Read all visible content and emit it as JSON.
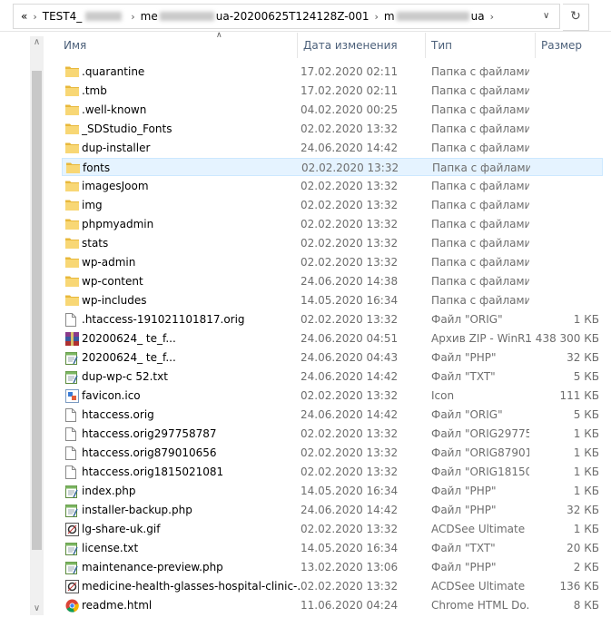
{
  "address": {
    "overflow": "«",
    "segments": [
      "TEST4_",
      "me",
      "ua-20200625T124128Z-001",
      "m",
      "ua"
    ],
    "refresh_icon": "refresh-icon"
  },
  "columns": {
    "name": "Имя",
    "date": "Дата изменения",
    "type": "Тип",
    "size": "Размер"
  },
  "rows": [
    {
      "name": ".quarantine",
      "date": "17.02.2020 02:11",
      "type": "Папка с файлами",
      "size": "",
      "icon": "folder"
    },
    {
      "name": ".tmb",
      "date": "17.02.2020 02:11",
      "type": "Папка с файлами",
      "size": "",
      "icon": "folder"
    },
    {
      "name": ".well-known",
      "date": "04.02.2020 00:25",
      "type": "Папка с файлами",
      "size": "",
      "icon": "folder"
    },
    {
      "name": "_SDStudio_Fonts",
      "date": "02.02.2020 13:32",
      "type": "Папка с файлами",
      "size": "",
      "icon": "folder"
    },
    {
      "name": "dup-installer",
      "date": "24.06.2020 14:42",
      "type": "Папка с файлами",
      "size": "",
      "icon": "folder"
    },
    {
      "name": "fonts",
      "date": "02.02.2020 13:32",
      "type": "Папка с файлами",
      "size": "",
      "icon": "folder",
      "selected": true
    },
    {
      "name": "imagesJoom",
      "date": "02.02.2020 13:32",
      "type": "Папка с файлами",
      "size": "",
      "icon": "folder"
    },
    {
      "name": "img",
      "date": "02.02.2020 13:32",
      "type": "Папка с файлами",
      "size": "",
      "icon": "folder"
    },
    {
      "name": "phpmyadmin",
      "date": "02.02.2020 13:32",
      "type": "Папка с файлами",
      "size": "",
      "icon": "folder"
    },
    {
      "name": "stats",
      "date": "02.02.2020 13:32",
      "type": "Папка с файлами",
      "size": "",
      "icon": "folder"
    },
    {
      "name": "wp-admin",
      "date": "02.02.2020 13:32",
      "type": "Папка с файлами",
      "size": "",
      "icon": "folder"
    },
    {
      "name": "wp-content",
      "date": "24.06.2020 14:38",
      "type": "Папка с файлами",
      "size": "",
      "icon": "folder"
    },
    {
      "name": "wp-includes",
      "date": "14.05.2020 16:34",
      "type": "Папка с файлами",
      "size": "",
      "icon": "folder"
    },
    {
      "name": ".htaccess-191021101817.orig",
      "date": "02.02.2020 13:32",
      "type": "Файл \"ORIG\"",
      "size": "1 КБ",
      "icon": "file"
    },
    {
      "name": "20200624_            te_f...",
      "date": "24.06.2020 04:51",
      "type": "Архив ZIP - WinR...",
      "size": "1 438 300 КБ",
      "icon": "archive"
    },
    {
      "name": "20200624_            te_f...",
      "date": "24.06.2020 04:43",
      "type": "Файл \"PHP\"",
      "size": "32 КБ",
      "icon": "notepad"
    },
    {
      "name": "dup-wp-c            52.txt",
      "date": "24.06.2020 14:42",
      "type": "Файл \"TXT\"",
      "size": "5 КБ",
      "icon": "notepad"
    },
    {
      "name": "favicon.ico",
      "date": "02.02.2020 13:32",
      "type": "Icon",
      "size": "111 КБ",
      "icon": "image"
    },
    {
      "name": "htaccess.orig",
      "date": "24.06.2020 14:42",
      "type": "Файл \"ORIG\"",
      "size": "5 КБ",
      "icon": "file"
    },
    {
      "name": "htaccess.orig297758787",
      "date": "02.02.2020 13:32",
      "type": "Файл \"ORIG29775...",
      "size": "1 КБ",
      "icon": "file"
    },
    {
      "name": "htaccess.orig879010656",
      "date": "02.02.2020 13:32",
      "type": "Файл \"ORIG87901...",
      "size": "1 КБ",
      "icon": "file"
    },
    {
      "name": "htaccess.orig1815021081",
      "date": "02.02.2020 13:32",
      "type": "Файл \"ORIG18150...",
      "size": "1 КБ",
      "icon": "file"
    },
    {
      "name": "index.php",
      "date": "14.05.2020 16:34",
      "type": "Файл \"PHP\"",
      "size": "1 КБ",
      "icon": "notepad"
    },
    {
      "name": "installer-backup.php",
      "date": "24.06.2020 14:42",
      "type": "Файл \"PHP\"",
      "size": "32 КБ",
      "icon": "notepad"
    },
    {
      "name": "lg-share-uk.gif",
      "date": "02.02.2020 13:32",
      "type": "ACDSee Ultimate ...",
      "size": "1 КБ",
      "icon": "acdsee"
    },
    {
      "name": "license.txt",
      "date": "14.05.2020 16:34",
      "type": "Файл \"TXT\"",
      "size": "20 КБ",
      "icon": "notepad"
    },
    {
      "name": "maintenance-preview.php",
      "date": "13.02.2020 13:06",
      "type": "Файл \"PHP\"",
      "size": "2 КБ",
      "icon": "notepad"
    },
    {
      "name": "medicine-health-glasses-hospital-clinic-...",
      "date": "02.02.2020 13:32",
      "type": "ACDSee Ultimate ...",
      "size": "136 КБ",
      "icon": "acdsee"
    },
    {
      "name": "readme.html",
      "date": "11.06.2020 04:24",
      "type": "Chrome HTML Do...",
      "size": "8 КБ",
      "icon": "chrome"
    }
  ]
}
